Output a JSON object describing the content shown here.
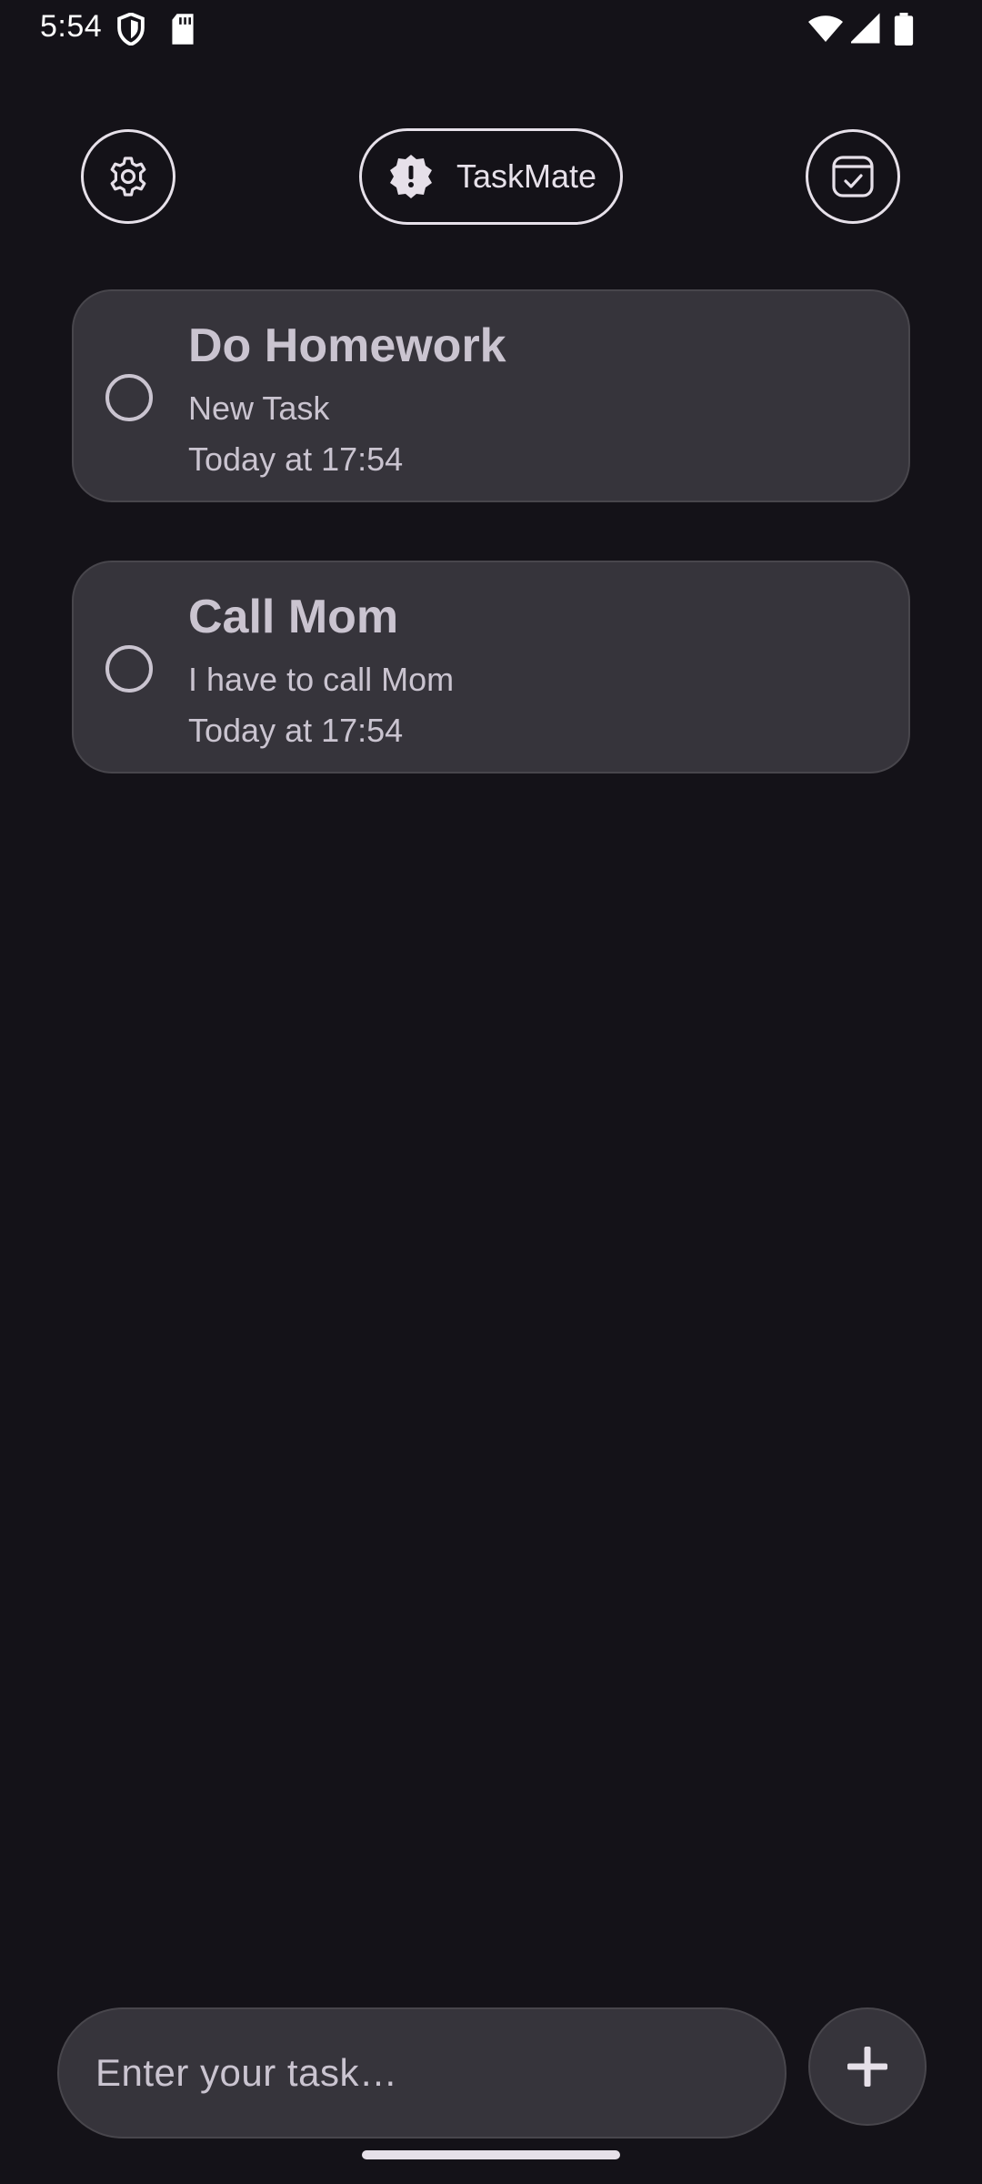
{
  "status_bar": {
    "time": "5:54",
    "icons": [
      "shield-icon",
      "sd-card-icon",
      "wifi-icon",
      "signal-icon",
      "battery-icon"
    ]
  },
  "header": {
    "title": "TaskMate",
    "left_button_icon": "gear-icon",
    "right_button_icon": "task-check-icon",
    "title_icon": "alert-badge-icon"
  },
  "tasks": [
    {
      "title": "Do Homework",
      "description": "New Task",
      "time": "Today at 17:54",
      "completed": false
    },
    {
      "title": "Call Mom",
      "description": "I have to call Mom",
      "time": "Today at 17:54",
      "completed": false
    }
  ],
  "input": {
    "placeholder": "Enter your task…",
    "value": ""
  },
  "colors": {
    "background": "#141218",
    "card": "#36343b",
    "text": "#cac4d0",
    "outline": "#e6e0e9"
  }
}
